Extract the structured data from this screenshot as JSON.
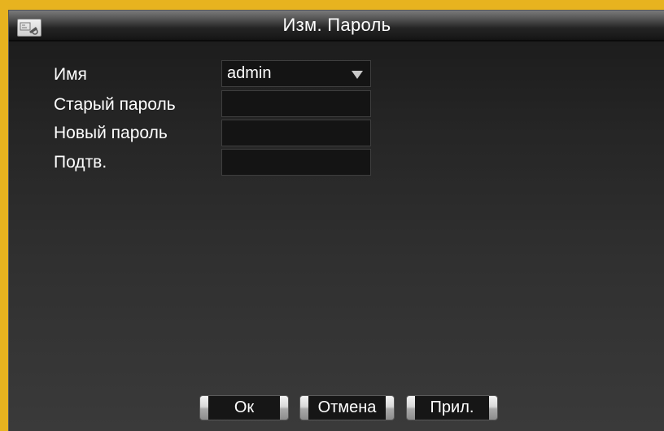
{
  "window": {
    "title": "Изм. Пароль"
  },
  "form": {
    "name_label": "Имя",
    "name_value": "admin",
    "old_password_label": "Старый пароль",
    "old_password_value": "",
    "new_password_label": "Новый пароль",
    "new_password_value": "",
    "confirm_label": "Подтв.",
    "confirm_value": ""
  },
  "buttons": {
    "ok": "Ок",
    "cancel": "Отмена",
    "apply": "Прил."
  },
  "colors": {
    "frame_border": "#e7b31f",
    "window_bg": "#2a2a2a",
    "field_bg": "#141414",
    "text": "#ffffff"
  },
  "icons": {
    "title_icon": "window-icon",
    "dropdown_icon": "chevron-down-icon"
  }
}
